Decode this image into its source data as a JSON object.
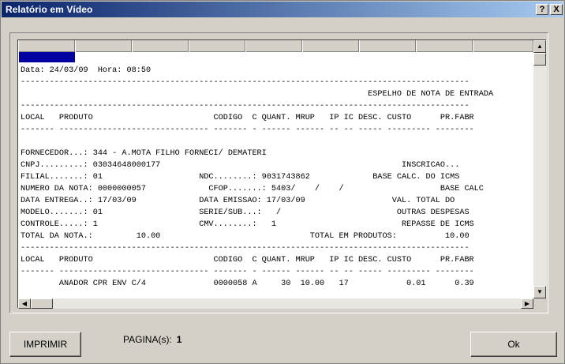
{
  "window": {
    "title": "Relatório em Vídeo",
    "help_label": "?",
    "close_label": "X"
  },
  "report": {
    "text": "Data: 24/03/09  Hora: 08:50\n---------------------------------------------------------------------------------------------\n                                                                        ESPELHO DE NOTA DE ENTRADA\n---------------------------------------------------------------------------------------------\nLOCAL   PRODUTO                         CODIGO  C QUANT. MRUP   IP IC DESC. CUSTO      PR.FABR\n------- ------------------------------- ------- - ------ ------ -- -- ----- --------- --------\n\nFORNECEDOR...: 344 - A.MOTA FILHO FORNECI/ DEMATERI\nCNPJ.........: 03034648000177                                                  INSCRICAO...\nFILIAL.......: 01                    NDC........: 9031743862             BASE CALC. DO ICMS\nNUMERO DA NOTA: 0000000057             CFOP.......: 5403/    /    /                    BASE CALC\nDATA ENTREGA..: 17/03/09             DATA EMISSAO: 17/03/09                  VAL. TOTAL DO\nMODELO.......: 01                    SERIE/SUB...:   /                        OUTRAS DESPESAS\nCONTROLE.....: 1                     CMV........:   1                          REPASSE DE ICMS\nTOTAL DA NOTA.:         10.00                               TOTAL EM PRODUTOS:          10.00\n---------------------------------------------------------------------------------------------\nLOCAL   PRODUTO                         CODIGO  C QUANT. MRUP   IP IC DESC. CUSTO      PR.FABR\n------- ------------------------------- ------- - ------ ------ -- -- ----- --------- --------\n        ANADOR CPR ENV C/4              0000058 A     30  10.00   17            0.01      0.39"
  },
  "footer": {
    "print_label": "IMPRIMIR",
    "page_label": "PAGINA(s):",
    "page_value": "1",
    "ok_label": "Ok"
  },
  "icons": {
    "scroll_up": "arrow-up-icon",
    "scroll_down": "arrow-down-icon",
    "scroll_left": "arrow-left-icon",
    "scroll_right": "arrow-right-icon"
  },
  "colors": {
    "titlebar_start": "#0a246a",
    "titlebar_end": "#a6caf0",
    "window_bg": "#d4d0c8",
    "selection_marker": "#0000a0"
  }
}
